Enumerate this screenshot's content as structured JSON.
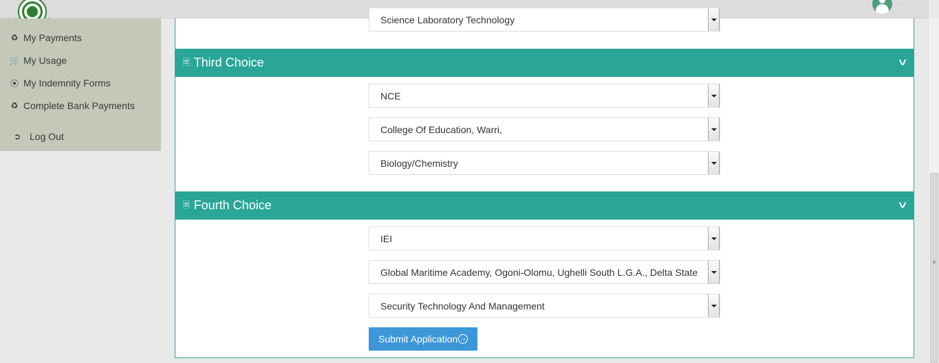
{
  "sidebar": {
    "items": [
      {
        "label": "My Payments",
        "icon": "recycle-icon"
      },
      {
        "label": "My Usage",
        "icon": "cart-icon"
      },
      {
        "label": "My Indemnity Forms",
        "icon": "circle-arrow-icon"
      },
      {
        "label": "Complete Bank Payments",
        "icon": "recycle-icon"
      }
    ],
    "logout_label": "Log Out"
  },
  "choices": {
    "second": {
      "course": "Science Laboratory Technology"
    },
    "third": {
      "title": "Third Choice",
      "level": "NCE",
      "institution": "College Of Education, Warri,",
      "course": "Biology/Chemistry"
    },
    "fourth": {
      "title": "Fourth Choice",
      "level": "IEI",
      "institution": "Global Maritime Academy, Ogoni-Olomu, Ughelli South L.G.A., Delta State",
      "course": "Security Technology And Management"
    }
  },
  "submit_label": "Submit Application",
  "colors": {
    "accent": "#29a698",
    "sidebar_bg": "#c3c8b8",
    "submit": "#3c97d9"
  }
}
